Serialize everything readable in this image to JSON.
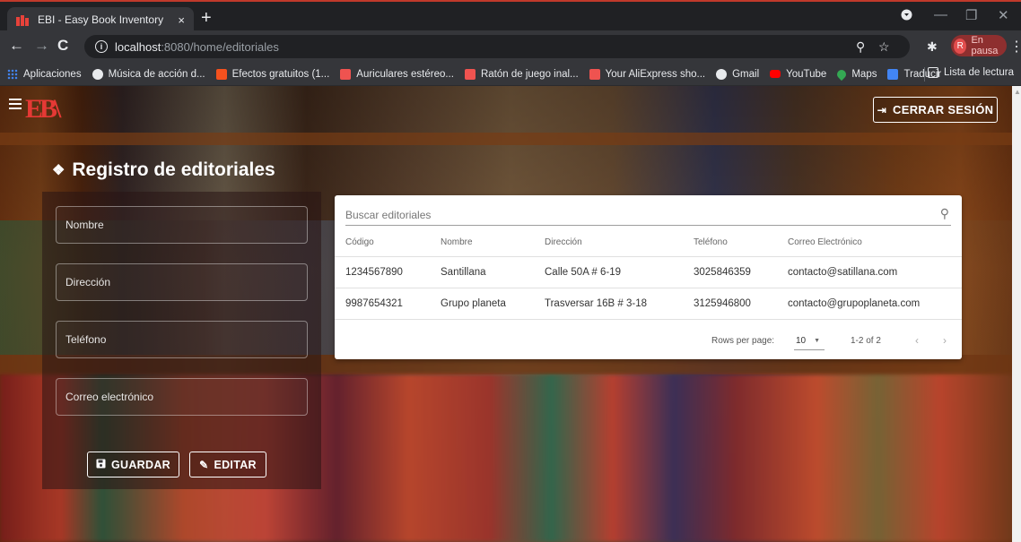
{
  "browser": {
    "tab_title": "EBI - Easy Book Inventory",
    "tab_close": "×",
    "new_tab": "+",
    "url_host": "localhost",
    "url_rest": ":8080/home/editoriales",
    "profile_initial": "R",
    "profile_status": "En pausa",
    "bookmarks": [
      {
        "label": "Aplicaciones",
        "color": "#e8eaed"
      },
      {
        "label": "Música de acción d...",
        "color": "#e8eaed"
      },
      {
        "label": "Efectos gratuitos (1...",
        "color": "#f4511e"
      },
      {
        "label": "Auriculares estéreo...",
        "color": "#ef5350"
      },
      {
        "label": "Ratón de juego inal...",
        "color": "#ef5350"
      },
      {
        "label": "Your AliExpress sho...",
        "color": "#ef5350"
      },
      {
        "label": "Gmail",
        "color": "#e8eaed"
      },
      {
        "label": "YouTube",
        "color": "#ff0000"
      },
      {
        "label": "Maps",
        "color": "#34a853"
      },
      {
        "label": "Traducir",
        "color": "#4285f4"
      }
    ],
    "reading_list": "Lista de lectura"
  },
  "app": {
    "logo": "EB\\",
    "logout_label": "CERRAR SESIÓN",
    "page_title": "Registro de editoriales"
  },
  "form": {
    "name_placeholder": "Nombre",
    "address_placeholder": "Dirección",
    "phone_placeholder": "Teléfono",
    "email_placeholder": "Correo electrónico",
    "save_label": "GUARDAR",
    "edit_label": "EDITAR"
  },
  "table": {
    "search_placeholder": "Buscar editoriales",
    "columns": [
      "Código",
      "Nombre",
      "Dirección",
      "Teléfono",
      "Correo Electrónico"
    ],
    "rows": [
      [
        "1234567890",
        "Santillana",
        "Calle 50A # 6-19",
        "3025846359",
        "contacto@satillana.com"
      ],
      [
        "9987654321",
        "Grupo planeta",
        "Trasversar 16B # 3-18",
        "3125946800",
        "contacto@grupoplaneta.com"
      ]
    ],
    "rows_per_page_label": "Rows per page:",
    "rows_per_page_value": "10",
    "page_range": "1-2 of 2"
  },
  "colors": {
    "accent_red": "#e53935",
    "profile_pill": "#8e2f2f"
  }
}
